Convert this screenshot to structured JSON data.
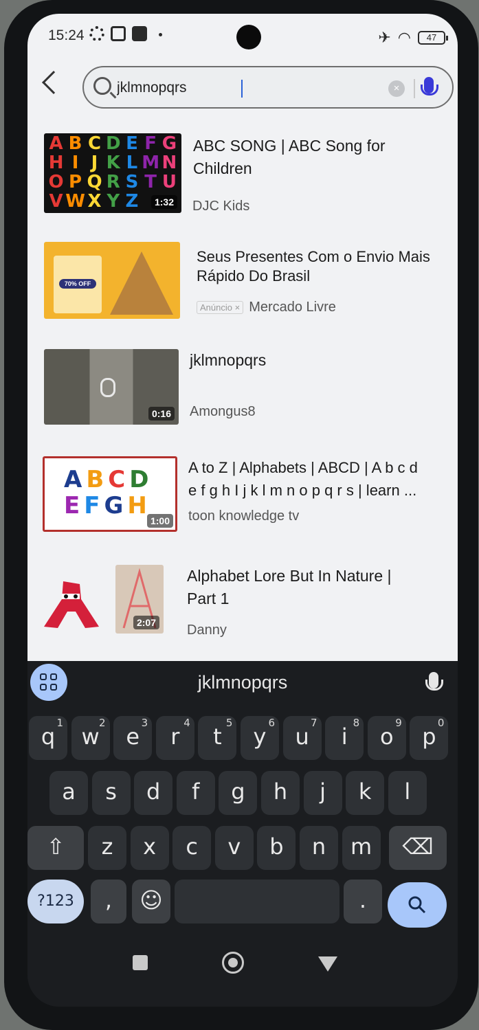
{
  "status_bar": {
    "time": "15:24",
    "battery": "47",
    "airplane_icon": "airplane-icon",
    "wifi_icon": "wifi-icon"
  },
  "search": {
    "query": "jklmnopqrs",
    "back_icon": "back-arrow-icon",
    "clear_icon": "clear-icon",
    "voice_icon": "mic-icon"
  },
  "results": [
    {
      "title_line1": "ABC SONG | ABC Song for",
      "title_line2": "Children",
      "channel": "DJC Kids",
      "duration": "1:32"
    },
    {
      "title_line1": "Seus Presentes Com o Envio Mais",
      "title_line2": "Rápido Do Brasil",
      "channel": "Mercado Livre",
      "ad_badge": "Anúncio ×"
    },
    {
      "title_line1": "jklmnopqrs",
      "title_line2": "",
      "channel": "Amongus8",
      "duration": "0:16"
    },
    {
      "title_line1": "A to Z | Alphabets | ABCD | A b c d",
      "title_line2": "e f g h I j k l m n o p q r s | learn ...",
      "channel": "toon knowledge tv",
      "duration": "1:00"
    },
    {
      "title_line1": "Alphabet Lore But In Nature |",
      "title_line2": "Part 1",
      "channel": "Danny",
      "duration": "2:07"
    }
  ],
  "thumb_text": {
    "abc_letters": [
      "A",
      "B",
      "C",
      "D",
      "E",
      "F",
      "G",
      "H",
      "I",
      "J",
      "K",
      "L",
      "M",
      "N",
      "O",
      "P",
      "Q",
      "R",
      "S",
      "T",
      "U",
      "V",
      "W",
      "X",
      "Y",
      "Z"
    ],
    "az_row1": "ABCD",
    "az_row2": "EFGH",
    "ad_pct": "70% OFF"
  },
  "keyboard": {
    "suggestion": "jklmnopqrs",
    "row1": [
      {
        "k": "q",
        "n": "1"
      },
      {
        "k": "w",
        "n": "2"
      },
      {
        "k": "e",
        "n": "3"
      },
      {
        "k": "r",
        "n": "4"
      },
      {
        "k": "t",
        "n": "5"
      },
      {
        "k": "y",
        "n": "6"
      },
      {
        "k": "u",
        "n": "7"
      },
      {
        "k": "i",
        "n": "8"
      },
      {
        "k": "o",
        "n": "9"
      },
      {
        "k": "p",
        "n": "0"
      }
    ],
    "row2": [
      "a",
      "s",
      "d",
      "f",
      "g",
      "h",
      "j",
      "k",
      "l"
    ],
    "row3": [
      "z",
      "x",
      "c",
      "v",
      "b",
      "n",
      "m"
    ],
    "symbols_key": "?123",
    "comma_key": ",",
    "period_key": ".",
    "emoji_icon": "emoji-icon",
    "shift_icon": "shift-icon",
    "backspace_icon": "backspace-icon",
    "search_icon": "search-icon"
  },
  "colors": {
    "accent_blue": "#a8c7fa",
    "app_bg": "#f1f2f4",
    "keyboard_bg": "#1b1d20"
  }
}
